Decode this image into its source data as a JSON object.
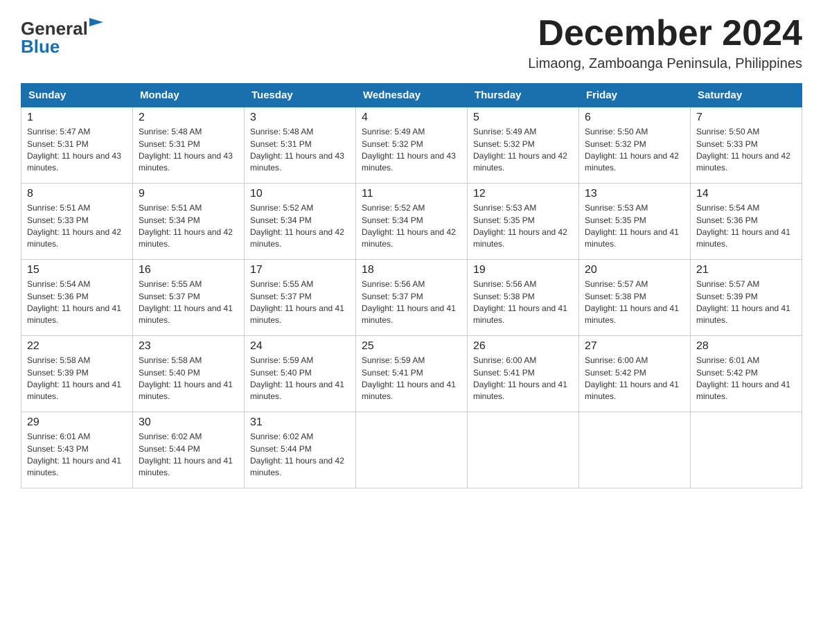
{
  "logo": {
    "general": "General",
    "blue": "Blue"
  },
  "title": "December 2024",
  "location": "Limaong, Zamboanga Peninsula, Philippines",
  "days_of_week": [
    "Sunday",
    "Monday",
    "Tuesday",
    "Wednesday",
    "Thursday",
    "Friday",
    "Saturday"
  ],
  "weeks": [
    [
      {
        "day": "1",
        "sunrise": "5:47 AM",
        "sunset": "5:31 PM",
        "daylight": "11 hours and 43 minutes."
      },
      {
        "day": "2",
        "sunrise": "5:48 AM",
        "sunset": "5:31 PM",
        "daylight": "11 hours and 43 minutes."
      },
      {
        "day": "3",
        "sunrise": "5:48 AM",
        "sunset": "5:31 PM",
        "daylight": "11 hours and 43 minutes."
      },
      {
        "day": "4",
        "sunrise": "5:49 AM",
        "sunset": "5:32 PM",
        "daylight": "11 hours and 43 minutes."
      },
      {
        "day": "5",
        "sunrise": "5:49 AM",
        "sunset": "5:32 PM",
        "daylight": "11 hours and 42 minutes."
      },
      {
        "day": "6",
        "sunrise": "5:50 AM",
        "sunset": "5:32 PM",
        "daylight": "11 hours and 42 minutes."
      },
      {
        "day": "7",
        "sunrise": "5:50 AM",
        "sunset": "5:33 PM",
        "daylight": "11 hours and 42 minutes."
      }
    ],
    [
      {
        "day": "8",
        "sunrise": "5:51 AM",
        "sunset": "5:33 PM",
        "daylight": "11 hours and 42 minutes."
      },
      {
        "day": "9",
        "sunrise": "5:51 AM",
        "sunset": "5:34 PM",
        "daylight": "11 hours and 42 minutes."
      },
      {
        "day": "10",
        "sunrise": "5:52 AM",
        "sunset": "5:34 PM",
        "daylight": "11 hours and 42 minutes."
      },
      {
        "day": "11",
        "sunrise": "5:52 AM",
        "sunset": "5:34 PM",
        "daylight": "11 hours and 42 minutes."
      },
      {
        "day": "12",
        "sunrise": "5:53 AM",
        "sunset": "5:35 PM",
        "daylight": "11 hours and 42 minutes."
      },
      {
        "day": "13",
        "sunrise": "5:53 AM",
        "sunset": "5:35 PM",
        "daylight": "11 hours and 41 minutes."
      },
      {
        "day": "14",
        "sunrise": "5:54 AM",
        "sunset": "5:36 PM",
        "daylight": "11 hours and 41 minutes."
      }
    ],
    [
      {
        "day": "15",
        "sunrise": "5:54 AM",
        "sunset": "5:36 PM",
        "daylight": "11 hours and 41 minutes."
      },
      {
        "day": "16",
        "sunrise": "5:55 AM",
        "sunset": "5:37 PM",
        "daylight": "11 hours and 41 minutes."
      },
      {
        "day": "17",
        "sunrise": "5:55 AM",
        "sunset": "5:37 PM",
        "daylight": "11 hours and 41 minutes."
      },
      {
        "day": "18",
        "sunrise": "5:56 AM",
        "sunset": "5:37 PM",
        "daylight": "11 hours and 41 minutes."
      },
      {
        "day": "19",
        "sunrise": "5:56 AM",
        "sunset": "5:38 PM",
        "daylight": "11 hours and 41 minutes."
      },
      {
        "day": "20",
        "sunrise": "5:57 AM",
        "sunset": "5:38 PM",
        "daylight": "11 hours and 41 minutes."
      },
      {
        "day": "21",
        "sunrise": "5:57 AM",
        "sunset": "5:39 PM",
        "daylight": "11 hours and 41 minutes."
      }
    ],
    [
      {
        "day": "22",
        "sunrise": "5:58 AM",
        "sunset": "5:39 PM",
        "daylight": "11 hours and 41 minutes."
      },
      {
        "day": "23",
        "sunrise": "5:58 AM",
        "sunset": "5:40 PM",
        "daylight": "11 hours and 41 minutes."
      },
      {
        "day": "24",
        "sunrise": "5:59 AM",
        "sunset": "5:40 PM",
        "daylight": "11 hours and 41 minutes."
      },
      {
        "day": "25",
        "sunrise": "5:59 AM",
        "sunset": "5:41 PM",
        "daylight": "11 hours and 41 minutes."
      },
      {
        "day": "26",
        "sunrise": "6:00 AM",
        "sunset": "5:41 PM",
        "daylight": "11 hours and 41 minutes."
      },
      {
        "day": "27",
        "sunrise": "6:00 AM",
        "sunset": "5:42 PM",
        "daylight": "11 hours and 41 minutes."
      },
      {
        "day": "28",
        "sunrise": "6:01 AM",
        "sunset": "5:42 PM",
        "daylight": "11 hours and 41 minutes."
      }
    ],
    [
      {
        "day": "29",
        "sunrise": "6:01 AM",
        "sunset": "5:43 PM",
        "daylight": "11 hours and 41 minutes."
      },
      {
        "day": "30",
        "sunrise": "6:02 AM",
        "sunset": "5:44 PM",
        "daylight": "11 hours and 41 minutes."
      },
      {
        "day": "31",
        "sunrise": "6:02 AM",
        "sunset": "5:44 PM",
        "daylight": "11 hours and 42 minutes."
      },
      null,
      null,
      null,
      null
    ]
  ]
}
